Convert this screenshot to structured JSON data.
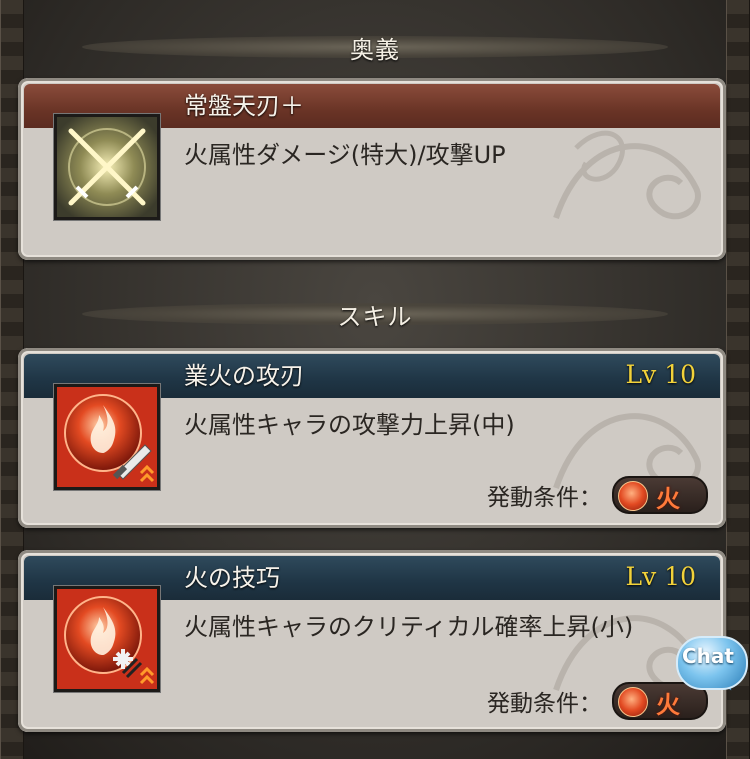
{
  "sections": {
    "ougi_title": "奥義",
    "skill_title": "スキル"
  },
  "ougi": {
    "name": "常盤天刃＋",
    "description": "火属性ダメージ(特大)/攻撃UP",
    "icon": "crossed-swords-icon"
  },
  "skills": [
    {
      "name": "業火の攻刃",
      "level": "Lv 10",
      "description": "火属性キャラの攻撃力上昇(中)",
      "condition_label": "発動条件：",
      "element": "火",
      "icon": "fire-attack-up-icon"
    },
    {
      "name": "火の技巧",
      "level": "Lv 10",
      "description": "火属性キャラのクリティカル確率上昇(小)",
      "condition_label": "発動条件：",
      "element": "火",
      "icon": "fire-critical-up-icon"
    }
  ],
  "chat_button": {
    "label": "Chat"
  },
  "colors": {
    "ougi_header": "#6a3426",
    "skill_header": "#1f3545",
    "level_text": "#f2d23a",
    "fire": "#e24a22"
  }
}
